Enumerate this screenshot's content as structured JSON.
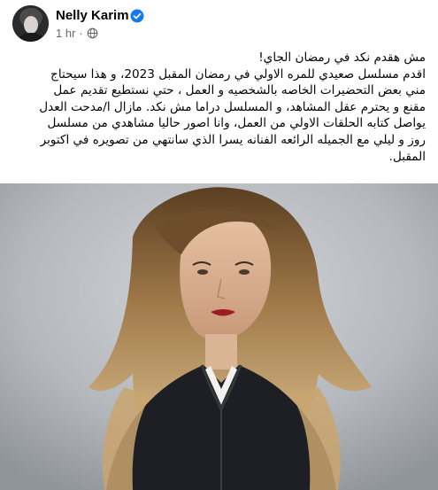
{
  "post": {
    "author": "Nelly Karim",
    "timestamp": "1 hr",
    "separator": "·",
    "verified_icon": "verified-badge-icon",
    "audience_icon": "globe-icon",
    "accent_color": "#1877f2",
    "text_lines": [
      "مش هقدم نكد في رمضان الجاي!",
      "اقدم مسلسل صعيدي للمره الاولي في رمضان المقبل 2023، و هذا سيحتاج",
      "مني بعض التحضيرات الخاصه بالشخصيه و العمل ، حتي نستطيع تقديم عمل",
      "مقنع و يحترم عقل المشاهد، و المسلسل دراما مش نكد. مازال ا/مدحت العدل",
      "يواصل كتابه الحلقات الاولي من العمل، وانا اصور حاليا مشاهدي من مسلسل",
      "روز و ليلي مع الجميله الرائعه الفنانه يسرا الذي سانتهي من تصويره في اكتوبر",
      "المقبل."
    ]
  }
}
